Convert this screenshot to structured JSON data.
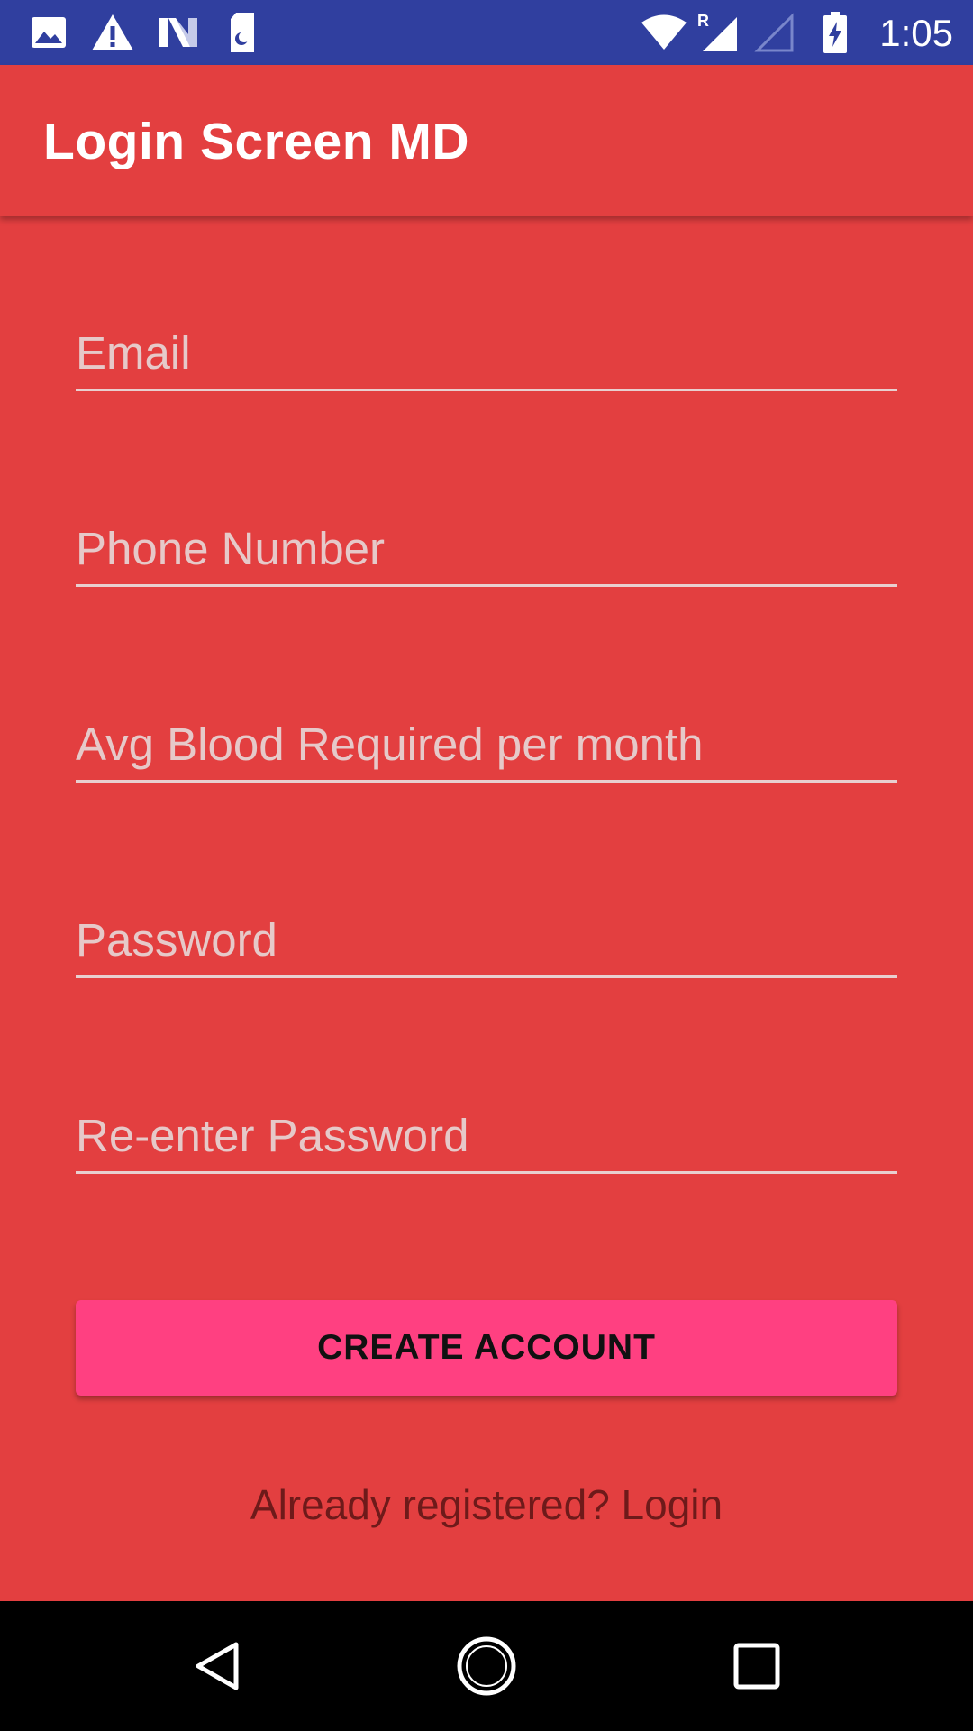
{
  "status_bar": {
    "time": "1:05",
    "icons": [
      "gallery-icon",
      "warning-icon",
      "n-icon",
      "sd-card-icon",
      "wifi-icon",
      "signal-roaming-icon",
      "signal-empty-icon",
      "battery-charging-icon"
    ],
    "background": "#303F9F"
  },
  "app_bar": {
    "title": "Login Screen MD",
    "background": "#E33F40"
  },
  "form": {
    "email": {
      "placeholder": "Email",
      "value": ""
    },
    "phone": {
      "placeholder": "Phone Number",
      "value": ""
    },
    "blood": {
      "placeholder": "Avg Blood Required per month",
      "value": ""
    },
    "password": {
      "placeholder": "Password",
      "value": ""
    },
    "reenter": {
      "placeholder": "Re-enter Password",
      "value": ""
    },
    "create_button": "CREATE ACCOUNT",
    "login_link": "Already registered? Login"
  },
  "colors": {
    "accent": "#FF4081",
    "background": "#E33F40"
  },
  "nav_bar": {
    "buttons": [
      "back-icon",
      "home-icon",
      "recents-icon"
    ]
  }
}
